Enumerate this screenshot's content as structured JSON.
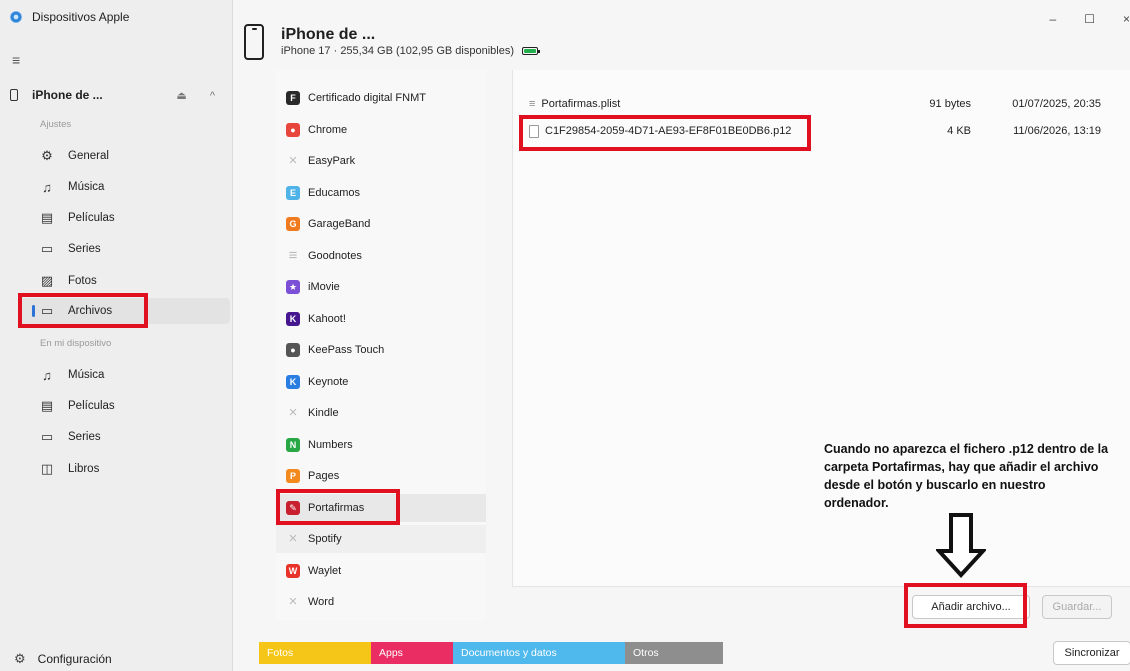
{
  "app": {
    "title": "Dispositivos Apple",
    "config_label": "Configuración"
  },
  "sidebar": {
    "device_name": "iPhone de ...",
    "device_controls": "⏏ ^",
    "sections": {
      "settings": "Ajustes",
      "on_device": "En mi dispositivo"
    },
    "settings_items": [
      {
        "label": "General",
        "icon": "gear-icon"
      },
      {
        "label": "Música",
        "icon": "music-note-icon"
      },
      {
        "label": "Películas",
        "icon": "film-icon"
      },
      {
        "label": "Series",
        "icon": "tv-icon"
      },
      {
        "label": "Fotos",
        "icon": "photo-icon"
      },
      {
        "label": "Archivos",
        "icon": "folder-icon"
      }
    ],
    "device_items": [
      {
        "label": "Música",
        "icon": "music-note-icon"
      },
      {
        "label": "Películas",
        "icon": "film-icon"
      },
      {
        "label": "Series",
        "icon": "tv-icon"
      },
      {
        "label": "Libros",
        "icon": "book-icon"
      }
    ]
  },
  "header": {
    "title": "iPhone de ...",
    "subtitle": "iPhone 17 · 255,34 GB (102,95 GB disponibles)",
    "window_controls": {
      "minimize": "–",
      "maximize": "☐",
      "close": "×"
    }
  },
  "apps": [
    {
      "name": "Certificado digital FNMT",
      "color": "#2a2a2a",
      "glyph": "F"
    },
    {
      "name": "Chrome",
      "color": "#e8453c",
      "glyph": "●"
    },
    {
      "name": "EasyPark",
      "color": "",
      "glyph": "×"
    },
    {
      "name": "Educamos",
      "color": "#4fb3e8",
      "glyph": "E"
    },
    {
      "name": "GarageBand",
      "color": "#f07a1d",
      "glyph": "G"
    },
    {
      "name": "Goodnotes",
      "color": "",
      "glyph": "≡"
    },
    {
      "name": "iMovie",
      "color": "#7b4fd6",
      "glyph": "★"
    },
    {
      "name": "Kahoot!",
      "color": "#46178f",
      "glyph": "K"
    },
    {
      "name": "KeePass Touch",
      "color": "#555555",
      "glyph": "●"
    },
    {
      "name": "Keynote",
      "color": "#2a7de1",
      "glyph": "K"
    },
    {
      "name": "Kindle",
      "color": "",
      "glyph": "×"
    },
    {
      "name": "Numbers",
      "color": "#27a845",
      "glyph": "N"
    },
    {
      "name": "Pages",
      "color": "#f28a1e",
      "glyph": "P"
    },
    {
      "name": "Portafirmas",
      "color": "#c8202f",
      "glyph": "✎"
    },
    {
      "name": "Spotify",
      "color": "",
      "glyph": "×"
    },
    {
      "name": "Waylet",
      "color": "#e8332a",
      "glyph": "W"
    },
    {
      "name": "Word",
      "color": "",
      "glyph": "×"
    }
  ],
  "files": [
    {
      "name": "Portafirmas.plist",
      "size": "91 bytes",
      "date": "01/07/2025, 20:35"
    },
    {
      "name": "C1F29854-2059-4D71-AE93-EF8F01BE0DB6.p12",
      "size": "4 KB",
      "date": "11/06/2026, 13:19"
    }
  ],
  "annotation": "Cuando no aparezca el fichero .p12 dentro de la carpeta Portafirmas, hay que añadir el archivo desde el botón y buscarlo en nuestro ordenador.",
  "buttons": {
    "add_file": "Añadir archivo...",
    "save": "Guardar...",
    "sync": "Sincronizar"
  },
  "storage": [
    {
      "label": "Fotos",
      "color": "#f5c518"
    },
    {
      "label": "Apps",
      "color": "#ea2d63"
    },
    {
      "label": "Documentos y datos",
      "color": "#4fb8ec"
    },
    {
      "label": "Otros",
      "color": "#8e8e8e"
    }
  ]
}
